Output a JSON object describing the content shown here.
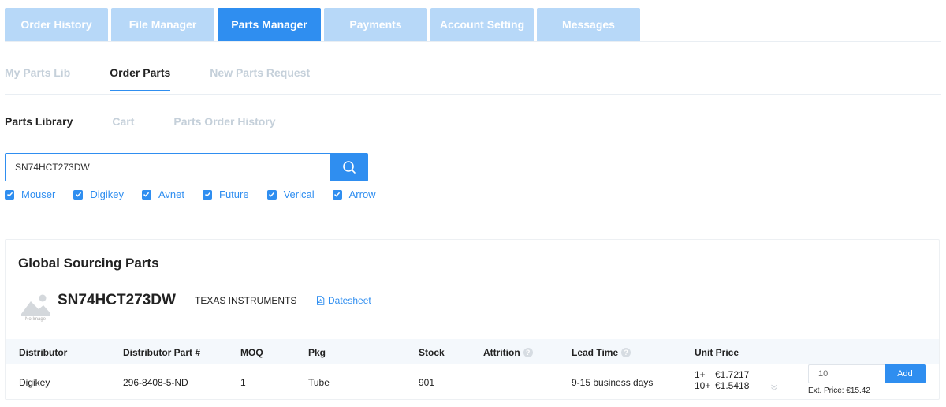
{
  "top_tabs": [
    {
      "label": "Order History",
      "active": false
    },
    {
      "label": "File Manager",
      "active": false
    },
    {
      "label": "Parts Manager",
      "active": true
    },
    {
      "label": "Payments",
      "active": false
    },
    {
      "label": "Account Setting",
      "active": false
    },
    {
      "label": "Messages",
      "active": false
    }
  ],
  "sub_tabs": [
    {
      "label": "My Parts Lib",
      "active": false
    },
    {
      "label": "Order Parts",
      "active": true
    },
    {
      "label": "New Parts Request",
      "active": false
    }
  ],
  "lib_tabs": [
    {
      "label": "Parts Library",
      "active": true
    },
    {
      "label": "Cart",
      "active": false
    },
    {
      "label": "Parts Order History",
      "active": false
    }
  ],
  "search": {
    "value": "SN74HCT273DW",
    "icon": "search-icon"
  },
  "sources": [
    {
      "label": "Mouser",
      "checked": true
    },
    {
      "label": "Digikey",
      "checked": true
    },
    {
      "label": "Avnet",
      "checked": true
    },
    {
      "label": "Future",
      "checked": true
    },
    {
      "label": "Verical",
      "checked": true
    },
    {
      "label": "Arrow",
      "checked": true
    }
  ],
  "panel": {
    "title": "Global Sourcing Parts",
    "part": {
      "image_label": "No Image",
      "number": "SN74HCT273DW",
      "manufacturer": "TEXAS INSTRUMENTS",
      "datasheet_label": "Datesheet"
    },
    "columns": {
      "distributor": "Distributor",
      "distributor_part": "Distributor Part #",
      "moq": "MOQ",
      "pkg": "Pkg",
      "stock": "Stock",
      "attrition": "Attrition",
      "lead_time": "Lead Time",
      "unit_price": "Unit Price"
    },
    "row": {
      "distributor": "Digikey",
      "distributor_part": "296-8408-5-ND",
      "moq": "1",
      "pkg": "Tube",
      "stock": "901",
      "attrition": "",
      "lead_time": "9-15 business days",
      "prices": [
        {
          "qty": "1+",
          "price": "€1.7217"
        },
        {
          "qty": "10+",
          "price": "€1.5418"
        }
      ],
      "quantity": "10",
      "add_label": "Add",
      "ext_price": "Ext. Price: €15.42"
    }
  },
  "colors": {
    "accent": "#2f8ef0",
    "tab_inactive": "#b7d8f8",
    "muted_text": "#c5d0da",
    "header_bg": "#f4f8fc"
  }
}
